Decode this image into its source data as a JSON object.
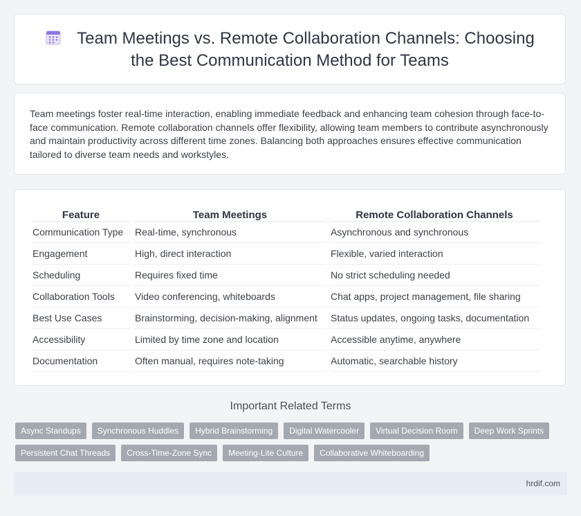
{
  "header": {
    "title": "Team Meetings vs. Remote Collaboration Channels: Choosing the Best Communication Method for Teams",
    "icon": "calendar-icon"
  },
  "intro": {
    "text": "Team meetings foster real-time interaction, enabling immediate feedback and enhancing team cohesion through face-to-face communication. Remote collaboration channels offer flexibility, allowing team members to contribute asynchronously and maintain productivity across different time zones. Balancing both approaches ensures effective communication tailored to diverse team needs and workstyles."
  },
  "table": {
    "headers": [
      "Feature",
      "Team Meetings",
      "Remote Collaboration Channels"
    ],
    "rows": [
      [
        "Communication Type",
        "Real-time, synchronous",
        "Asynchronous and synchronous"
      ],
      [
        "Engagement",
        "High, direct interaction",
        "Flexible, varied interaction"
      ],
      [
        "Scheduling",
        "Requires fixed time",
        "No strict scheduling needed"
      ],
      [
        "Collaboration Tools",
        "Video conferencing, whiteboards",
        "Chat apps, project management, file sharing"
      ],
      [
        "Best Use Cases",
        "Brainstorming, decision-making, alignment",
        "Status updates, ongoing tasks, documentation"
      ],
      [
        "Accessibility",
        "Limited by time zone and location",
        "Accessible anytime, anywhere"
      ],
      [
        "Documentation",
        "Often manual, requires note-taking",
        "Automatic, searchable history"
      ]
    ]
  },
  "related": {
    "title": "Important Related Terms",
    "tags": [
      "Async Standups",
      "Synchronous Huddles",
      "Hybrid Brainstorming",
      "Digital Watercooler",
      "Virtual Decision Room",
      "Deep Work Sprints",
      "Persistent Chat Threads",
      "Cross-Time-Zone Sync",
      "Meeting-Lite Culture",
      "Collaborative Whiteboarding"
    ]
  },
  "footer": {
    "site": "hrdif.com"
  },
  "colors": {
    "tag_bg": "#a4a9b1",
    "footer_bg": "#e8edf5",
    "icon_accent": "#8a7be0"
  }
}
